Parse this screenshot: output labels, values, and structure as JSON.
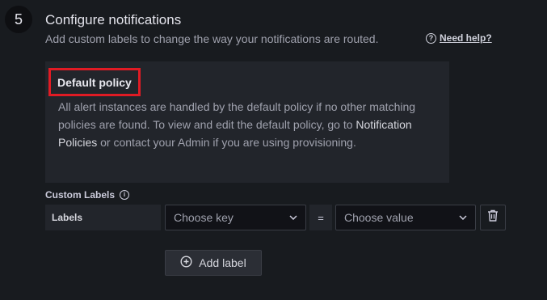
{
  "step": {
    "number": "5",
    "title": "Configure notifications",
    "subtitle": "Add custom labels to change the way your notifications are routed.",
    "help_link": "Need help?"
  },
  "policy": {
    "title": "Default policy",
    "desc_part1": "All alert instances are handled by the default policy if no other matching policies are found. To view and edit the default policy, go to ",
    "desc_link": "Notification Policies",
    "desc_part2": " or contact your Admin if you are using provisioning."
  },
  "custom_labels": {
    "heading": "Custom Labels",
    "row_label": "Labels",
    "key_placeholder": "Choose key",
    "operator": "=",
    "value_placeholder": "Choose value",
    "add_label": "Add label"
  },
  "colors": {
    "highlight": "#e01b24",
    "background": "#181b1f",
    "panel": "#22252b"
  }
}
